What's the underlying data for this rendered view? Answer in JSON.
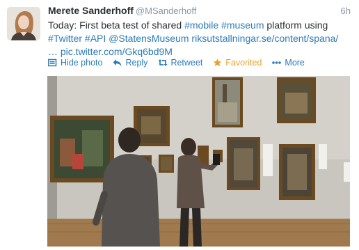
{
  "tweet": {
    "fullname": "Merete Sanderhoff",
    "username": "@MSanderhoff",
    "timestamp": "6h",
    "text": {
      "line1_plain": "Today: First beta test of shared ",
      "line1_tag1": "#mobile",
      "line1_space": " ",
      "line1_tag2": "#museum",
      "line1_end": " platform using",
      "line2_tag1": "#Twitter",
      "line2_tag2": "#API",
      "line2_mention": "@StatensMuseum",
      "line2_url": "riksutstallningar.se/content/spana/",
      "line3_ellipsis": "…",
      "line3_pic": "pic.twitter.com/Gkq6bd9M"
    }
  },
  "actions": {
    "hide_photo": "Hide photo",
    "reply": "Reply",
    "retweet": "Retweet",
    "favorited": "Favorited",
    "more": "More"
  },
  "colors": {
    "link": "#2b7bb9",
    "favorited": "#e8a327",
    "muted": "#8899a6"
  },
  "icons": {
    "hide_photo": "photo-icon",
    "reply": "reply-arrow-icon",
    "retweet": "retweet-icon",
    "favorited": "star-icon",
    "more": "dots-icon"
  }
}
